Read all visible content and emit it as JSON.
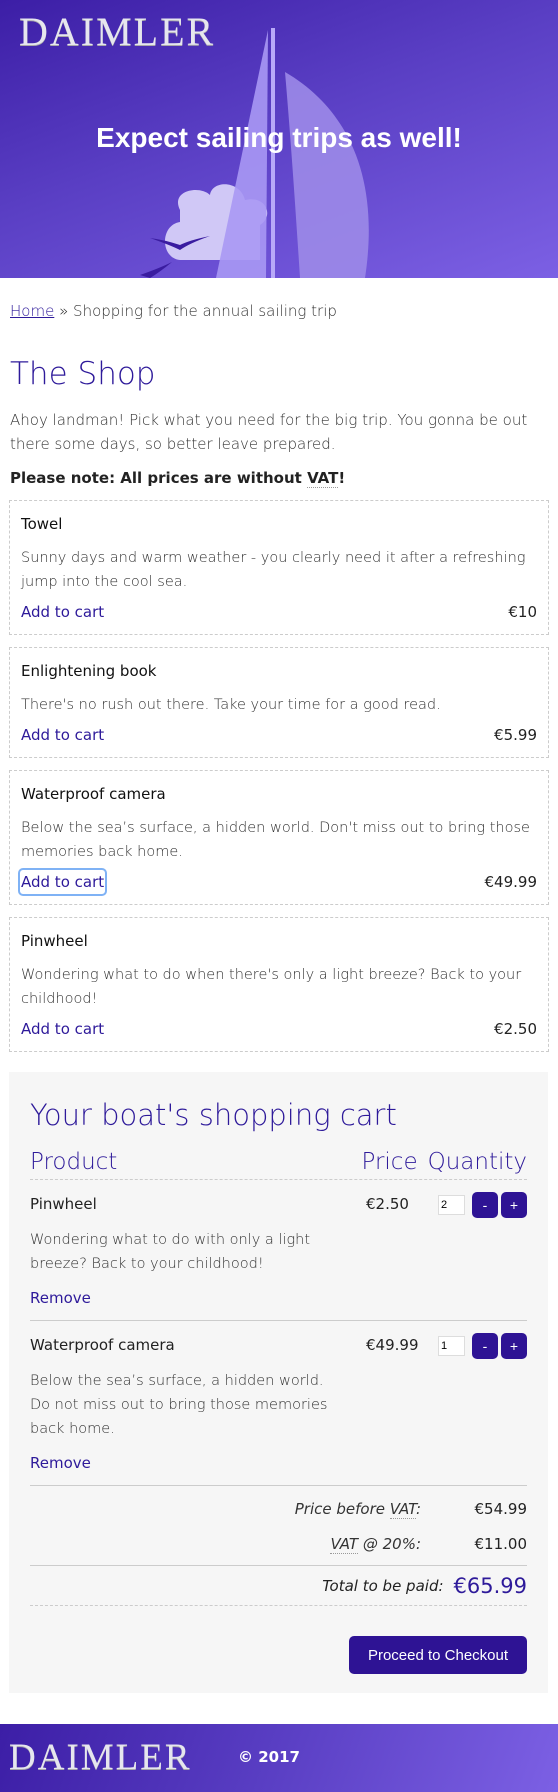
{
  "header": {
    "logo": "DAIMLER",
    "hero_title": "Expect sailing trips as well!"
  },
  "breadcrumb": {
    "home": "Home",
    "separator": "»",
    "current": "Shopping for the annual sailing trip"
  },
  "shop": {
    "title": "The Shop",
    "intro": "Ahoy landman! Pick what you need for the big trip. You gonna be out there some days, so better leave prepared.",
    "note_prefix": "Please note: All prices are without ",
    "note_vat": "VAT",
    "note_suffix": "!",
    "add_label": "Add to cart",
    "products": [
      {
        "name": "Towel",
        "description": "Sunny days and warm weather - you clearly need it after a refreshing jump into the cool sea.",
        "price": "€10"
      },
      {
        "name": "Enlightening book",
        "description": "There's no rush out there. Take your time for a good read.",
        "price": "€5.99"
      },
      {
        "name": "Waterproof camera",
        "description": "Below the sea’s surface, a hidden world. Don't miss out to bring those memories back home.",
        "price": "€49.99"
      },
      {
        "name": "Pinwheel",
        "description": "Wondering what to do when there's only a light breeze? Back to your childhood!",
        "price": "€2.50"
      }
    ]
  },
  "cart": {
    "title": "Your boat's shopping cart",
    "columns": {
      "product": "Product",
      "price": "Price",
      "quantity": "Quantity"
    },
    "remove_label": "Remove",
    "minus": "-",
    "plus": "+",
    "items": [
      {
        "name": "Pinwheel",
        "description": "Wondering what to do with only a light breeze? Back to your childhood!",
        "price": "€2.50",
        "quantity": "2"
      },
      {
        "name": "Waterproof camera",
        "description": "Below the sea’s surface, a hidden world. Do not miss out to bring those memories back home.",
        "price": "€49.99",
        "quantity": "1"
      }
    ],
    "price_before_label_prefix": "Price before ",
    "vat_word": "VAT",
    "colon": ":",
    "price_before_vat": "€54.99",
    "vat_at": " @ ",
    "vat_rate": "20",
    "percent": "%:",
    "vat_amount": "€11.00",
    "total_label": "Total to be paid:",
    "total": "€65.99",
    "checkout_label": "Proceed to Checkout"
  },
  "footer": {
    "logo": "DAIMLER",
    "copyright": "© 2017"
  }
}
